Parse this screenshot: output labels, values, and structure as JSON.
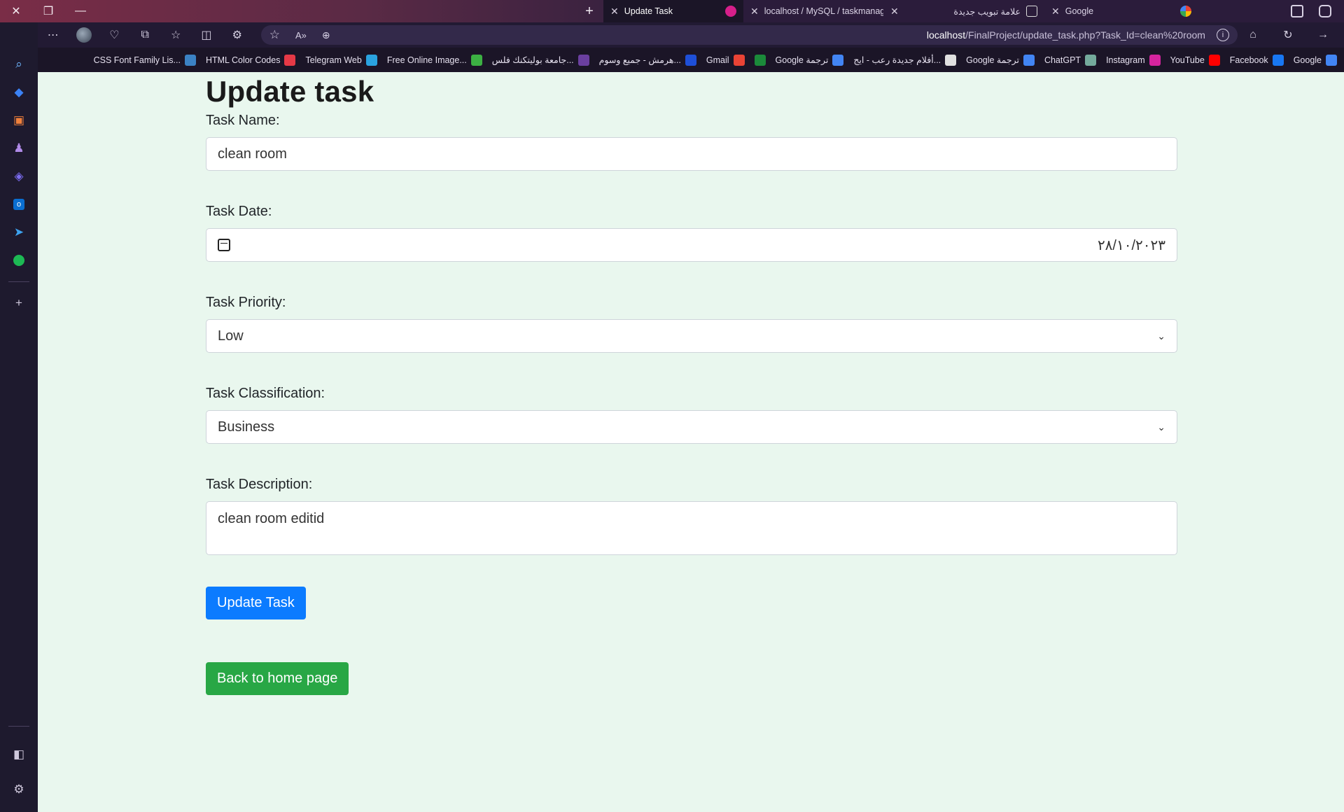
{
  "browser": {
    "tabs": [
      {
        "title": "Update Task",
        "active": true
      },
      {
        "title": "localhost / MySQL / taskmanagm"
      },
      {
        "title": "علامة تبويب جديدة"
      },
      {
        "title": "Google"
      }
    ],
    "address": {
      "host": "localhost",
      "path": "/FinalProject/update_task.php?Task_Id=clean%20room"
    },
    "bookmarks": [
      {
        "label": "CSS Font Family Lis...",
        "color": "#3b82c4",
        "icon": "css-icon"
      },
      {
        "label": "HTML Color Codes",
        "color": "#e63946",
        "icon": "color-icon"
      },
      {
        "label": "Telegram Web",
        "color": "#2aa3e0",
        "icon": "telegram-icon"
      },
      {
        "label": "Free Online Image...",
        "color": "#3cb043",
        "icon": "image-icon"
      },
      {
        "label": "جامعة بوليتكنك فلس...",
        "color": "#6b3fa0",
        "icon": "university-icon"
      },
      {
        "label": "هرمش - جميع وسوم...",
        "color": "#1e4fd8",
        "icon": "h-icon"
      },
      {
        "label": "Gmail",
        "color": "#ea4335",
        "icon": "gmail-icon"
      },
      {
        "label": "",
        "color": "#1b8a3a",
        "icon": "bookmark-icon"
      },
      {
        "label": "Google ترجمة",
        "color": "#4285f4",
        "icon": "translate-icon"
      },
      {
        "label": "أفلام جديدة رعب - ايج...",
        "color": "#e0e0e0",
        "icon": "movie-icon"
      },
      {
        "label": "Google ترجمة",
        "color": "#4285f4",
        "icon": "translate-icon"
      },
      {
        "label": "ChatGPT",
        "color": "#74aa9c",
        "icon": "chatgpt-icon"
      },
      {
        "label": "Instagram",
        "color": "#d6249f",
        "icon": "instagram-icon"
      },
      {
        "label": "YouTube",
        "color": "#ff0000",
        "icon": "youtube-icon"
      },
      {
        "label": "Facebook",
        "color": "#1877f2",
        "icon": "facebook-icon"
      },
      {
        "label": "Google",
        "color": "#4285f4",
        "icon": "google-icon"
      }
    ]
  },
  "form": {
    "title": "Update task",
    "task_name_label": "Task Name:",
    "task_name_value": "clean room",
    "task_date_label": "Task Date:",
    "task_date_value": "٢٨/١٠/٢٠٢٣",
    "task_priority_label": "Task Priority:",
    "task_priority_value": "Low",
    "task_classification_label": "Task Classification:",
    "task_classification_value": "Business",
    "task_description_label": "Task Description:",
    "task_description_value": "clean room editid",
    "update_button": "Update Task",
    "back_button": "Back to home page"
  },
  "colors": {
    "page_bg": "#e9f7ee",
    "primary": "#0b7bff",
    "success": "#28a745"
  }
}
